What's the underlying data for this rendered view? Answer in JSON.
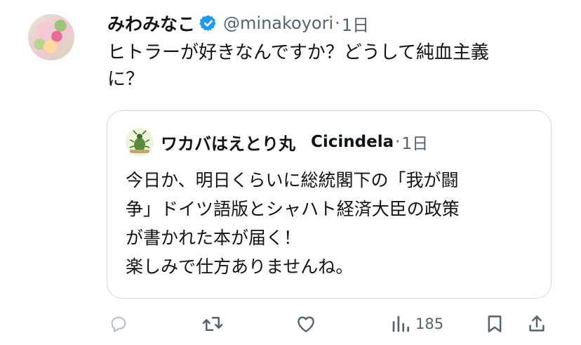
{
  "tweet": {
    "author_name": "みわみなこ",
    "handle": "@minakoyori",
    "separator": "·",
    "time": "1日",
    "text": "ヒトラーが好きなんですか？どうして純血主義\nに？"
  },
  "quote": {
    "author_name": "ワカバはえとり丸",
    "handle": "Cicindela",
    "separator": "·",
    "time": "1日",
    "text": "今日か、明日くらいに総統閣下の「我が闘\n争」ドイツ語版とシャハト経済大臣の政策\nが書かれた本が届く！\n楽しみで仕方ありませんね。"
  },
  "actions": {
    "views_count": "185"
  },
  "colors": {
    "verified": "#1d9bf0",
    "muted": "#536471",
    "border": "#cfd9de"
  }
}
